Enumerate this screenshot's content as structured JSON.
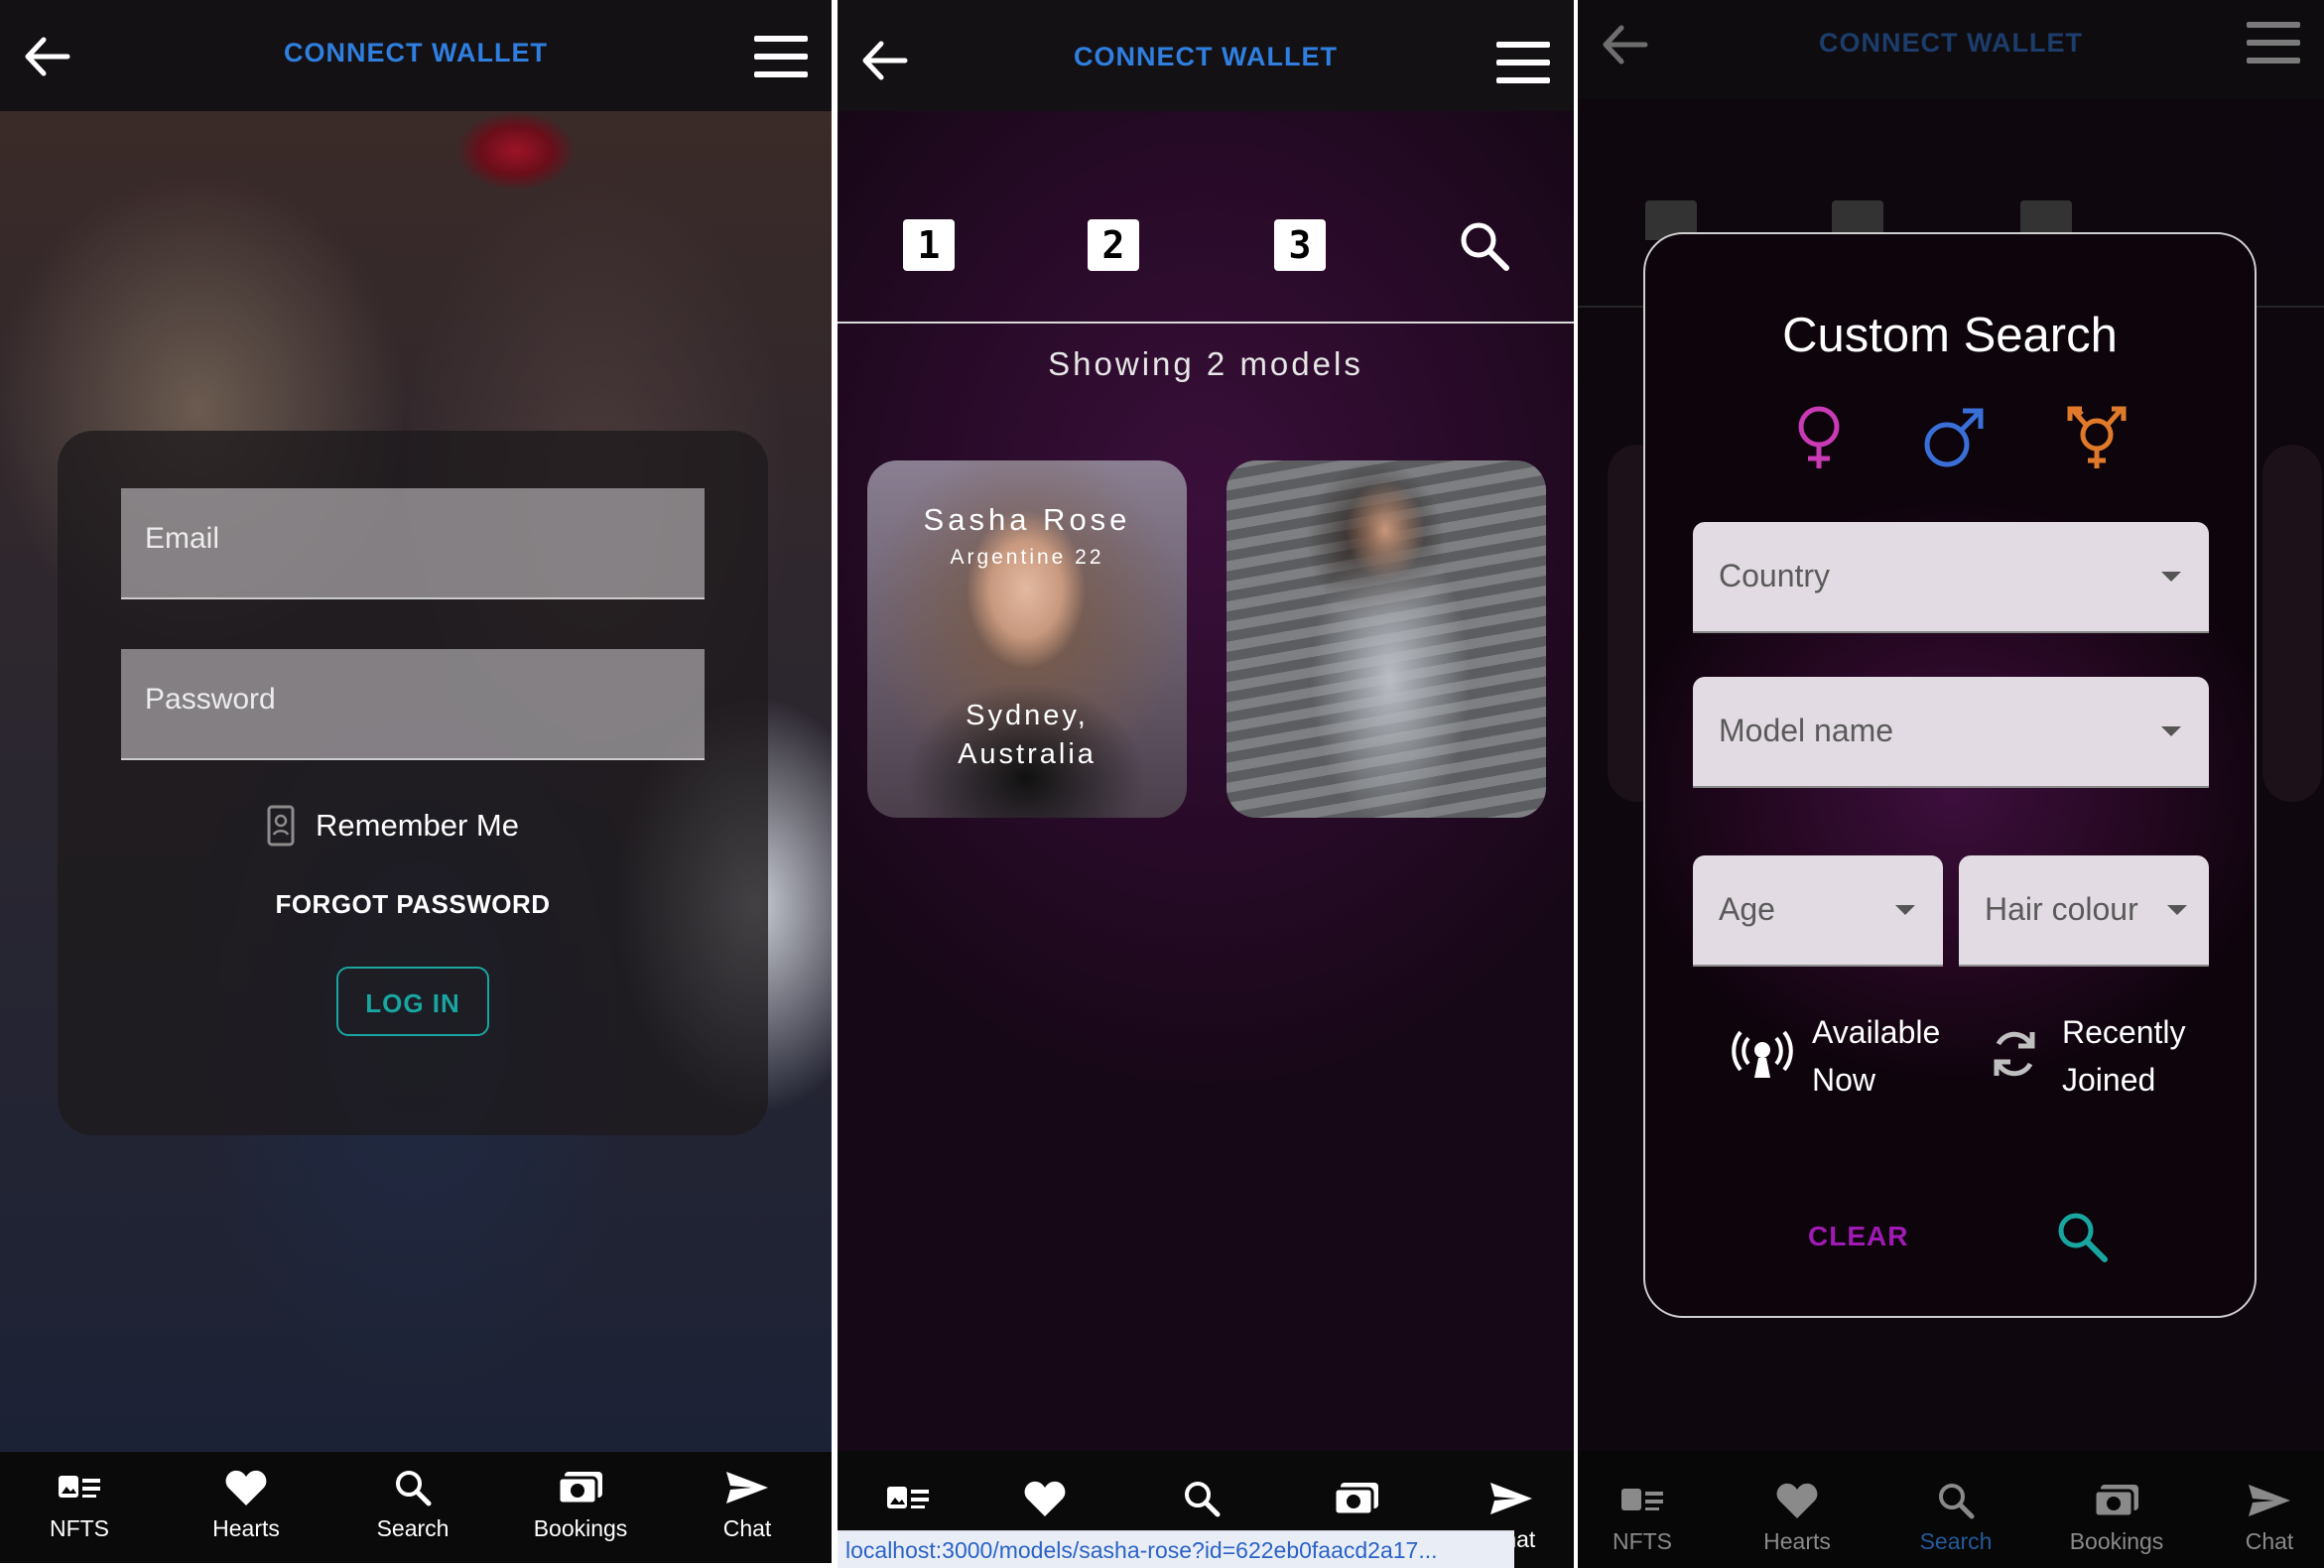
{
  "header": {
    "title": "CONNECT WALLET"
  },
  "nav": {
    "items": [
      {
        "label": "NFTS",
        "icon": "nft-card-icon"
      },
      {
        "label": "Hearts",
        "icon": "heart-icon"
      },
      {
        "label": "Search",
        "icon": "search-icon"
      },
      {
        "label": "Bookings",
        "icon": "bookings-icon"
      },
      {
        "label": "Chat",
        "icon": "send-icon"
      }
    ]
  },
  "login": {
    "email_placeholder": "Email",
    "password_placeholder": "Password",
    "remember_label": "Remember Me",
    "forgot_label": "FORGOT PASSWORD",
    "login_label": "LOG IN"
  },
  "models_page": {
    "pages": [
      "1",
      "2",
      "3"
    ],
    "showing_text": "Showing 2 models",
    "models": [
      {
        "name": "Sasha Rose",
        "subtitle": "Argentine 22",
        "location": "Sydney, Australia"
      },
      {
        "name": "",
        "subtitle": "",
        "location": ""
      }
    ],
    "status_url": "localhost:3000/models/sasha-rose?id=622eb0faacd2a17..."
  },
  "custom_search": {
    "title": "Custom Search",
    "genders": [
      "female-symbol-icon",
      "male-symbol-icon",
      "transgender-symbol-icon"
    ],
    "gender_colors": [
      "#c93ab5",
      "#3a6fd8",
      "#e07a2a"
    ],
    "country_label": "Country",
    "model_name_label": "Model name",
    "age_label": "Age",
    "hair_label": "Hair colour",
    "available_line1": "Available",
    "available_line2": "Now",
    "recent_line1": "Recently",
    "recent_line2": "Joined",
    "clear_label": "CLEAR",
    "active_nav": "Search"
  },
  "colors": {
    "accent_blue": "#2f7fe0",
    "teal": "#19a6a0",
    "purple": "#a01ab5"
  }
}
